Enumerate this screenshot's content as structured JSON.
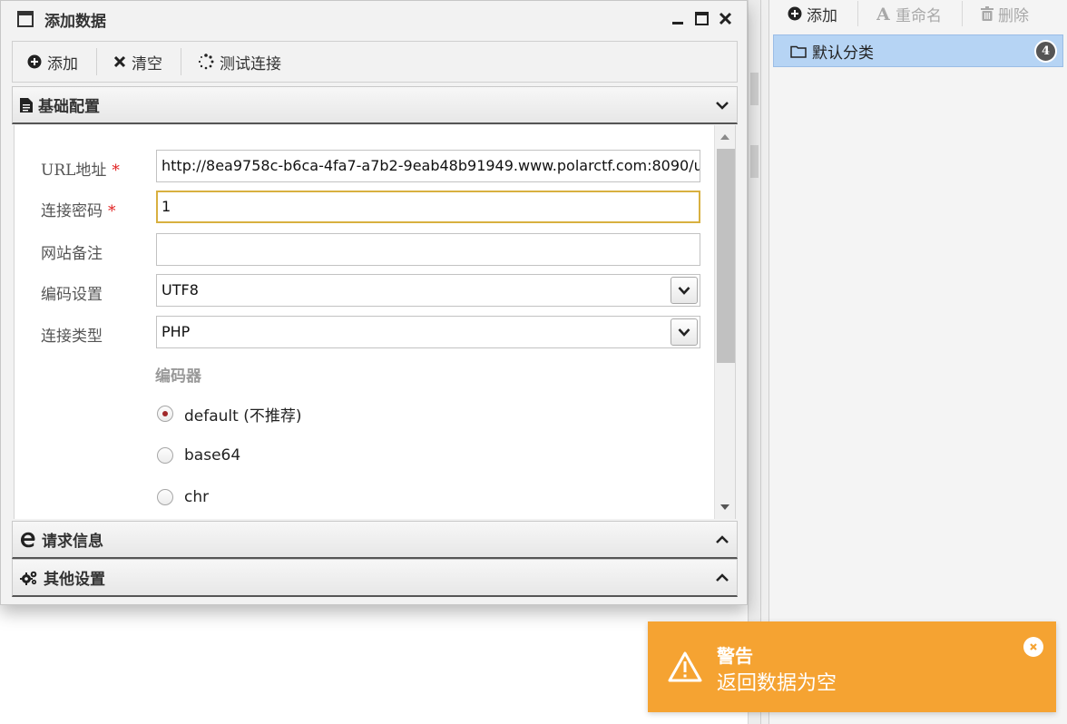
{
  "dialog": {
    "title": "添加数据",
    "icons": {
      "window": "window-icon",
      "minimize": "minimize-icon",
      "maximize": "maximize-icon",
      "close": "close-icon"
    }
  },
  "toolbar": {
    "add_label": "添加",
    "clear_label": "清空",
    "test_label": "测试连接"
  },
  "sections": {
    "basic": "基础配置",
    "request": "请求信息",
    "other": "其他设置"
  },
  "form": {
    "url_label": "URL地址",
    "url_value": "http://8ea9758c-b6ca-4fa7-a7b2-9eab48b91949.www.polarctf.com:8090/u",
    "password_label": "连接密码",
    "password_value": "1",
    "note_label": "网站备注",
    "note_value": "",
    "encoding_label": "编码设置",
    "encoding_value": "UTF8",
    "type_label": "连接类型",
    "type_value": "PHP",
    "required_mark": "*",
    "encoder_label": "编码器",
    "encoders": [
      "default (不推荐)",
      "base64",
      "chr"
    ],
    "selected_encoder": "default (不推荐)"
  },
  "right_panel": {
    "add_label": "添加",
    "rename_label": "重命名",
    "delete_label": "删除",
    "category_label": "默认分类",
    "category_count": "4"
  },
  "toast": {
    "title": "警告",
    "message": "返回数据为空"
  },
  "colors": {
    "toast_bg": "#f5a332",
    "selection": "#b6d4f4",
    "required": "#e02020",
    "focus_border": "#d8b040"
  }
}
